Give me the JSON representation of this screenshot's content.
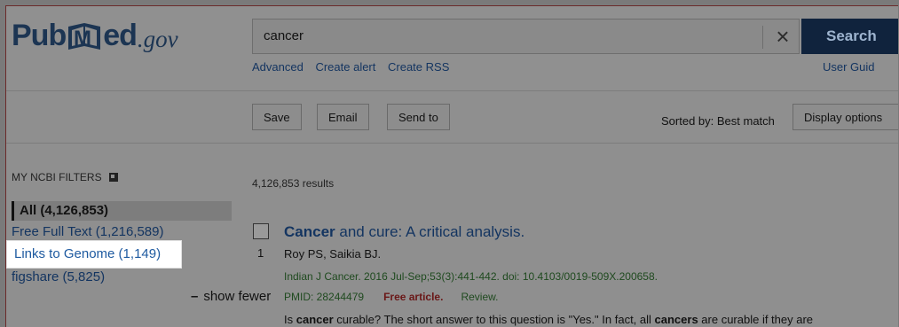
{
  "logo": {
    "pub": "Pub",
    "med": "ed",
    "gov": ".gov"
  },
  "search": {
    "value": "cancer",
    "clear_label": "×",
    "button_label": "Search"
  },
  "sublinks": {
    "advanced": "Advanced",
    "create_alert": "Create alert",
    "create_rss": "Create RSS",
    "user_guide": "User Guid"
  },
  "toolbar": {
    "save": "Save",
    "email": "Email",
    "send_to": "Send to",
    "sorted_by": "Sorted by: Best match",
    "display_options": "Display options"
  },
  "sidebar": {
    "title": "MY NCBI FILTERS",
    "filters": {
      "all": "All (4,126,853)",
      "free_full_text": "Free Full Text (1,216,589)",
      "links_to_genome": "Links to Genome (1,149)",
      "figshare": "figshare (5,825)"
    },
    "show_fewer": "show fewer"
  },
  "results": {
    "count": "4,126,853 results",
    "items": [
      {
        "num": "1",
        "title_bold": "Cancer",
        "title_rest": " and cure: A critical analysis.",
        "authors": "Roy PS, Saikia BJ.",
        "journal": "Indian J Cancer. 2016 Jul-Sep;53(3):441-442. doi: 10.4103/0019-509X.200658.",
        "pmid": "PMID: 28244479",
        "free": "Free article.",
        "review": "Review.",
        "snippet_1": "Is ",
        "snippet_b1": "cancer",
        "snippet_2": " curable? The short answer to this question is \"Yes.\" In fact, all ",
        "snippet_b2": "cancers",
        "snippet_3": " are curable if they are"
      }
    ]
  }
}
